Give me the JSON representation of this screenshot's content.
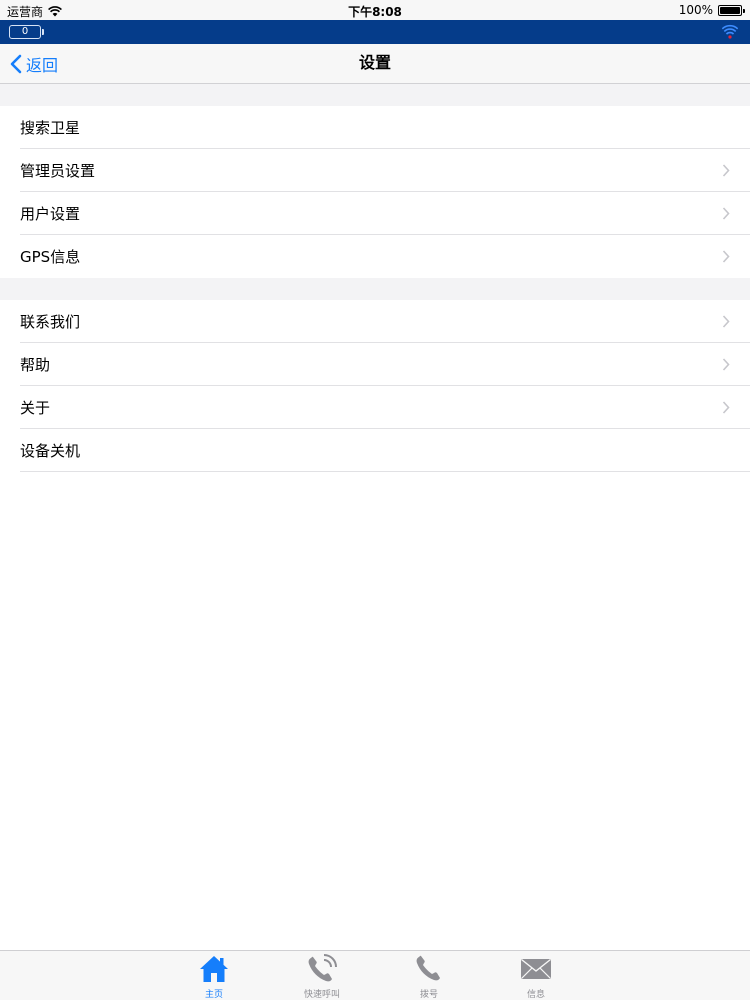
{
  "status_bar": {
    "carrier": "运营商",
    "time": "下午8:08",
    "battery": "100%"
  },
  "device_bar": {
    "battery_value": "0"
  },
  "nav": {
    "back_label": "返回",
    "title": "设置"
  },
  "sections": [
    {
      "items": [
        {
          "label": "搜索卫星",
          "chevron": false
        },
        {
          "label": "管理员设置",
          "chevron": true
        },
        {
          "label": "用户设置",
          "chevron": true
        },
        {
          "label": "GPS信息",
          "chevron": true
        }
      ]
    },
    {
      "items": [
        {
          "label": "联系我们",
          "chevron": true
        },
        {
          "label": "帮助",
          "chevron": true
        },
        {
          "label": "关于",
          "chevron": true
        },
        {
          "label": "设备关机",
          "chevron": false
        }
      ]
    }
  ],
  "tabs": [
    {
      "label": "主页",
      "icon": "home-icon",
      "active": true
    },
    {
      "label": "快速呼叫",
      "icon": "quick-call-icon",
      "active": false
    },
    {
      "label": "拨号",
      "icon": "phone-icon",
      "active": false
    },
    {
      "label": "信息",
      "icon": "envelope-icon",
      "active": false
    }
  ],
  "colors": {
    "accent": "#157efb",
    "device_bar": "#053c8a",
    "inactive_icon": "#8e8e93"
  }
}
